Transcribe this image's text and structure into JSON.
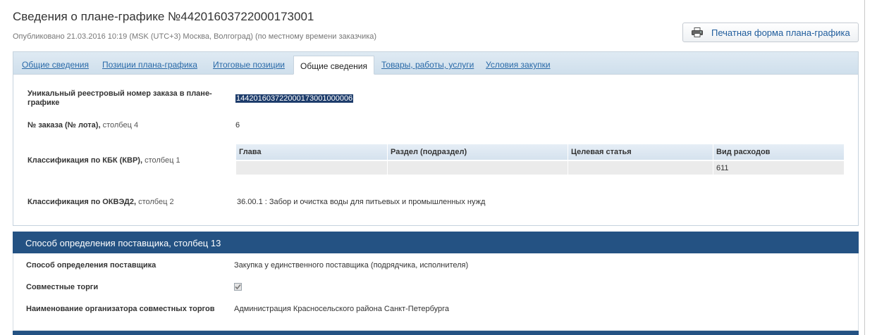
{
  "header": {
    "title": "Сведения о плане-графике №44201603722000173001",
    "published": "Опубликовано 21.03.2016 10:19 (MSK (UTC+3) Москва, Волгоград) (по местному времени заказчика)",
    "print_label": "Печатная форма плана-графика",
    "print_icon": "printer-icon"
  },
  "tabs": [
    {
      "label": "Общие сведения",
      "active": false
    },
    {
      "label": "Позиции плана-графика",
      "active": false
    },
    {
      "label": "Итоговые позиции",
      "active": false
    },
    {
      "label": "Общие сведения",
      "active": true
    },
    {
      "label": "Товары, работы, услуги",
      "active": false
    },
    {
      "label": "Условия закупки",
      "active": false
    }
  ],
  "general": {
    "reg_number_label": "Уникальный реестровый номер заказа в плане-графике",
    "reg_number_value": "144201603722000173001000006",
    "order_label": "№ заказа (№ лота),",
    "order_col": "столбец 4",
    "order_value": "6",
    "kbk_label": "Классификация по КБК (КВР),",
    "kbk_col": "столбец 1",
    "kbk_table": {
      "headers": [
        "Глава",
        "Раздел (подраздел)",
        "Целевая статья",
        "Вид расходов"
      ],
      "row": [
        "",
        "",
        "",
        "611"
      ]
    },
    "okved_label": "Классификация по ОКВЭД2,",
    "okved_col": "столбец 2",
    "okved_value": "36.00.1 : Забор и очистка воды для питьевых и промышленных нужд"
  },
  "supplier_section": {
    "title": "Способ определения поставщика, столбец 13",
    "method_label": "Способ определения поставщика",
    "method_value": "Закупка у единственного поставщика (подрядчика, исполнителя)",
    "joint_label": "Совместные торги",
    "joint_checked": true,
    "organizer_label": "Наименование организатора совместных торгов",
    "organizer_value": "Администрация Красносельского района Санкт-Петербурга"
  }
}
